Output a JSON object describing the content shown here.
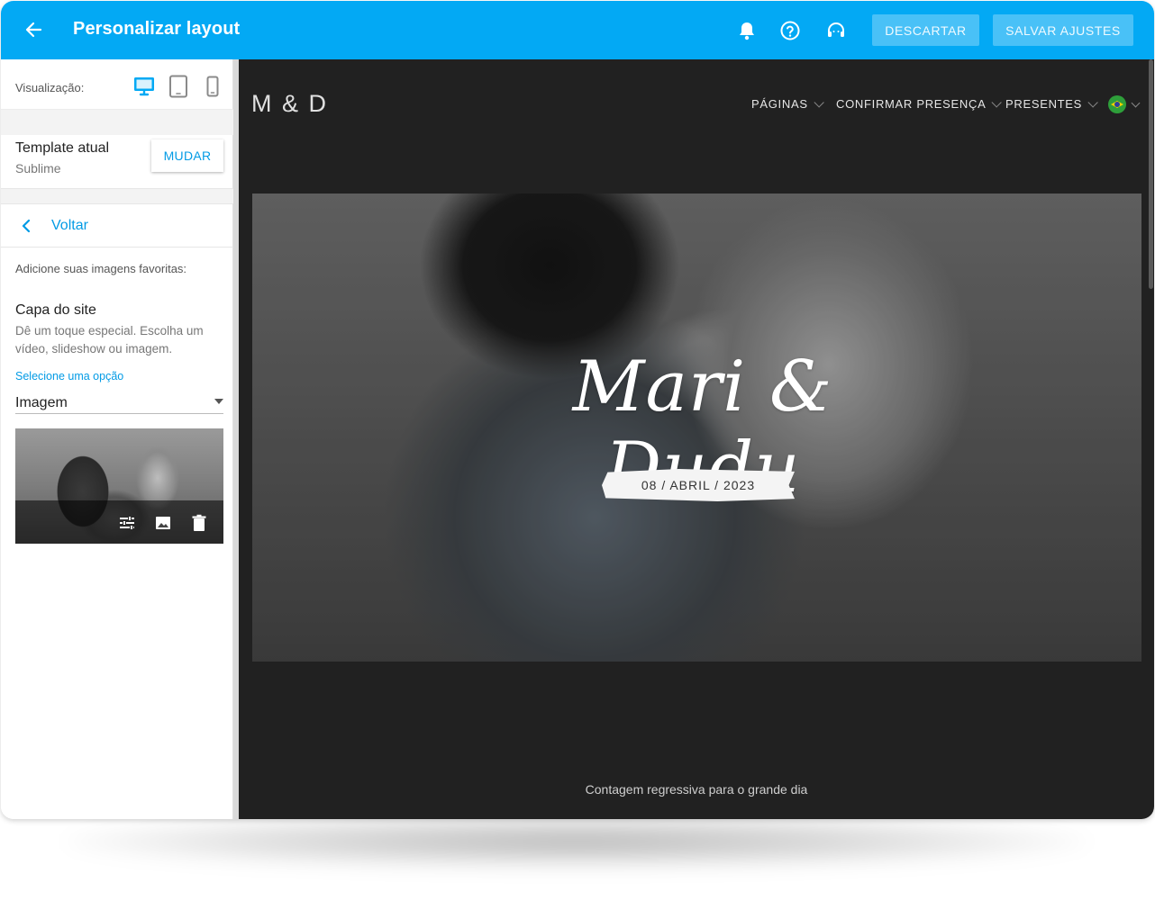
{
  "topbar": {
    "title": "Personalizar layout",
    "discard_label": "DESCARTAR",
    "save_label": "SALVAR AJUSTES"
  },
  "sidebar": {
    "view_label": "Visualização:",
    "template_title": "Template atual",
    "template_name": "Sublime",
    "change_label": "MUDAR",
    "back_label": "Voltar",
    "intro": "Adicione suas imagens favoritas:",
    "cover_title": "Capa do site",
    "cover_desc": "Dê um toque especial. Escolha um vídeo, slideshow ou imagem.",
    "select_label": "Selecione uma opção",
    "select_value": "Imagem"
  },
  "preview": {
    "logo": "M & D",
    "nav": [
      "PÁGINAS",
      "CONFIRMAR PRESENÇA",
      "PRESENTES"
    ],
    "names": "Mari & Dudu",
    "date": "08 / ABRIL / 2023",
    "countdown": "Contagem regressiva para o grande dia"
  },
  "colors": {
    "accent": "#03a9f4",
    "link": "#039be5",
    "preview_bg": "#212121"
  }
}
